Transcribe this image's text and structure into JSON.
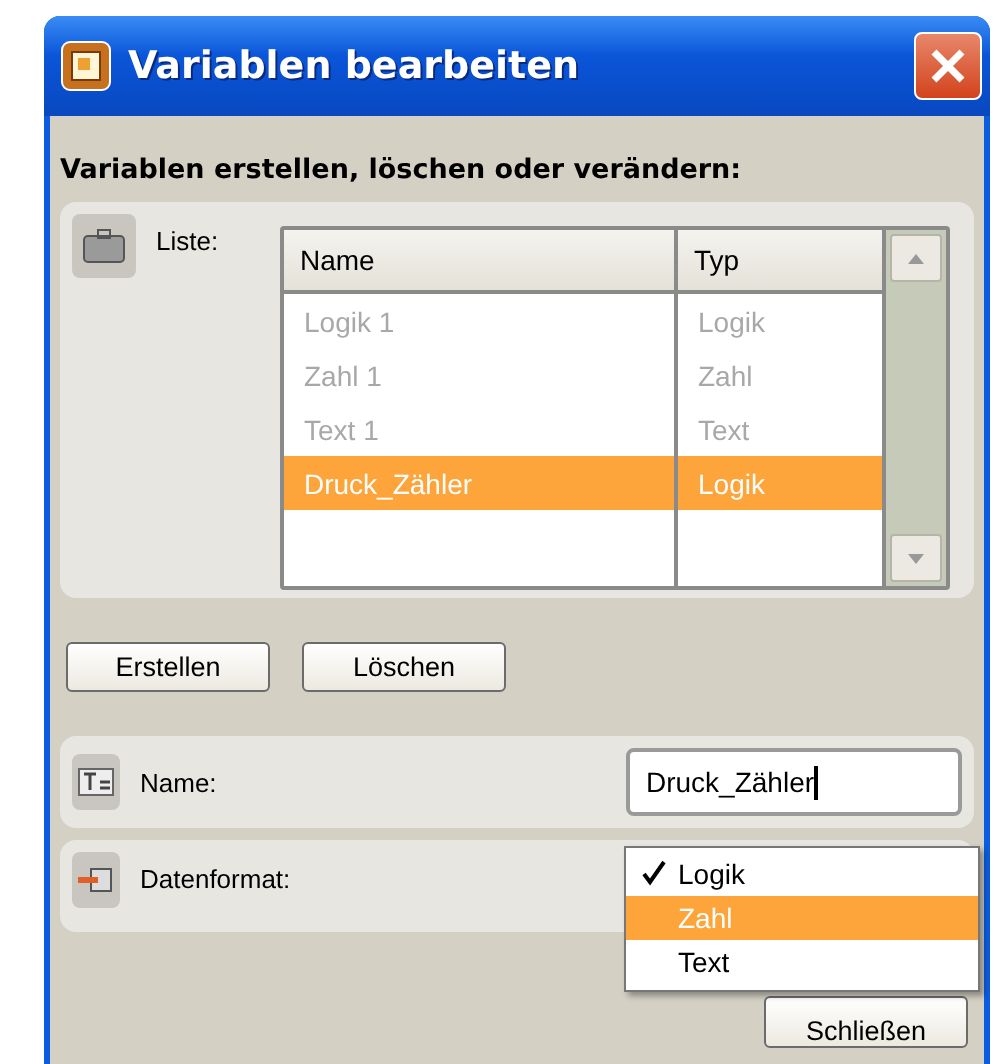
{
  "window": {
    "title": "Variablen bearbeiten"
  },
  "heading": "Variablen erstellen, löschen oder verändern:",
  "list": {
    "label": "Liste:",
    "columns": [
      "Name",
      "Typ"
    ],
    "rows": [
      {
        "name": "Logik 1",
        "type": "Logik",
        "selected": false
      },
      {
        "name": "Zahl 1",
        "type": "Zahl",
        "selected": false
      },
      {
        "name": "Text 1",
        "type": "Text",
        "selected": false
      },
      {
        "name": "Druck_Zähler",
        "type": "Logik",
        "selected": true
      }
    ]
  },
  "buttons": [
    "Erstellen",
    "Löschen"
  ],
  "name_field": {
    "label": "Name:",
    "value": "Druck_Zähler"
  },
  "format": {
    "label": "Datenformat:",
    "options": [
      {
        "label": "Logik",
        "checked": true,
        "selected": false
      },
      {
        "label": "Zahl",
        "checked": false,
        "selected": true
      },
      {
        "label": "Text",
        "checked": false,
        "selected": false
      }
    ]
  },
  "close_button": "Schließen"
}
